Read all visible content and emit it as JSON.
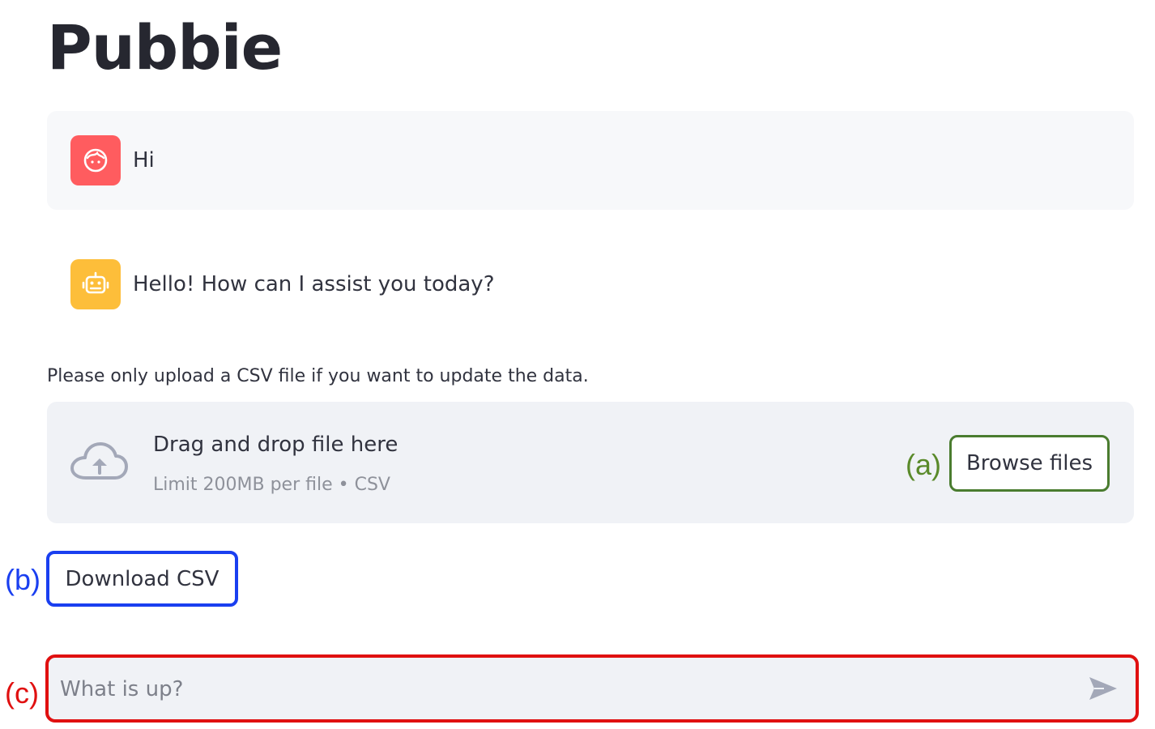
{
  "app": {
    "title": "Pubbie"
  },
  "messages": [
    {
      "role": "user",
      "avatar_icon": "user-face-icon",
      "avatar_color": "#ff5c5f",
      "text": "Hi"
    },
    {
      "role": "assistant",
      "avatar_icon": "robot-icon",
      "avatar_color": "#fdbe3a",
      "text": "Hello! How can I assist you today?"
    }
  ],
  "uploader": {
    "label": "Please only upload a CSV file if you want to update the data.",
    "drop_title": "Drag and drop file here",
    "limit_text": "Limit 200MB per file • CSV",
    "icon": "cloud-upload-icon",
    "browse_label": "Browse files"
  },
  "download": {
    "label": "Download CSV"
  },
  "chat_input": {
    "placeholder": "What is up?",
    "value": "",
    "send_icon": "send-icon"
  },
  "annotations": {
    "a": "(a)",
    "b": "(b)",
    "c": "(c)",
    "colors": {
      "a": "#5a8a2a",
      "b": "#1a3ff0",
      "c": "#e01010"
    }
  }
}
